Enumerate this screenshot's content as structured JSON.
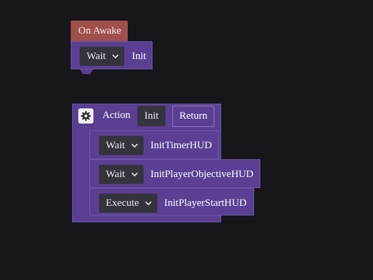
{
  "awake_event": {
    "label": "On Awake",
    "row": {
      "mode": "Wait",
      "target": "Init"
    }
  },
  "action_block": {
    "label": "Action",
    "name_chip": "Init",
    "return_button": "Return",
    "rows": [
      {
        "mode": "Wait",
        "target": "InitTimerHUD"
      },
      {
        "mode": "Wait",
        "target": "InitPlayerObjectiveHUD"
      },
      {
        "mode": "Execute",
        "target": "InitPlayerStartHUD"
      }
    ]
  },
  "colors": {
    "background": "#16161b",
    "event_block": "#a14f4a",
    "action_block": "#5a3f93",
    "dropdown": "#35343d"
  }
}
